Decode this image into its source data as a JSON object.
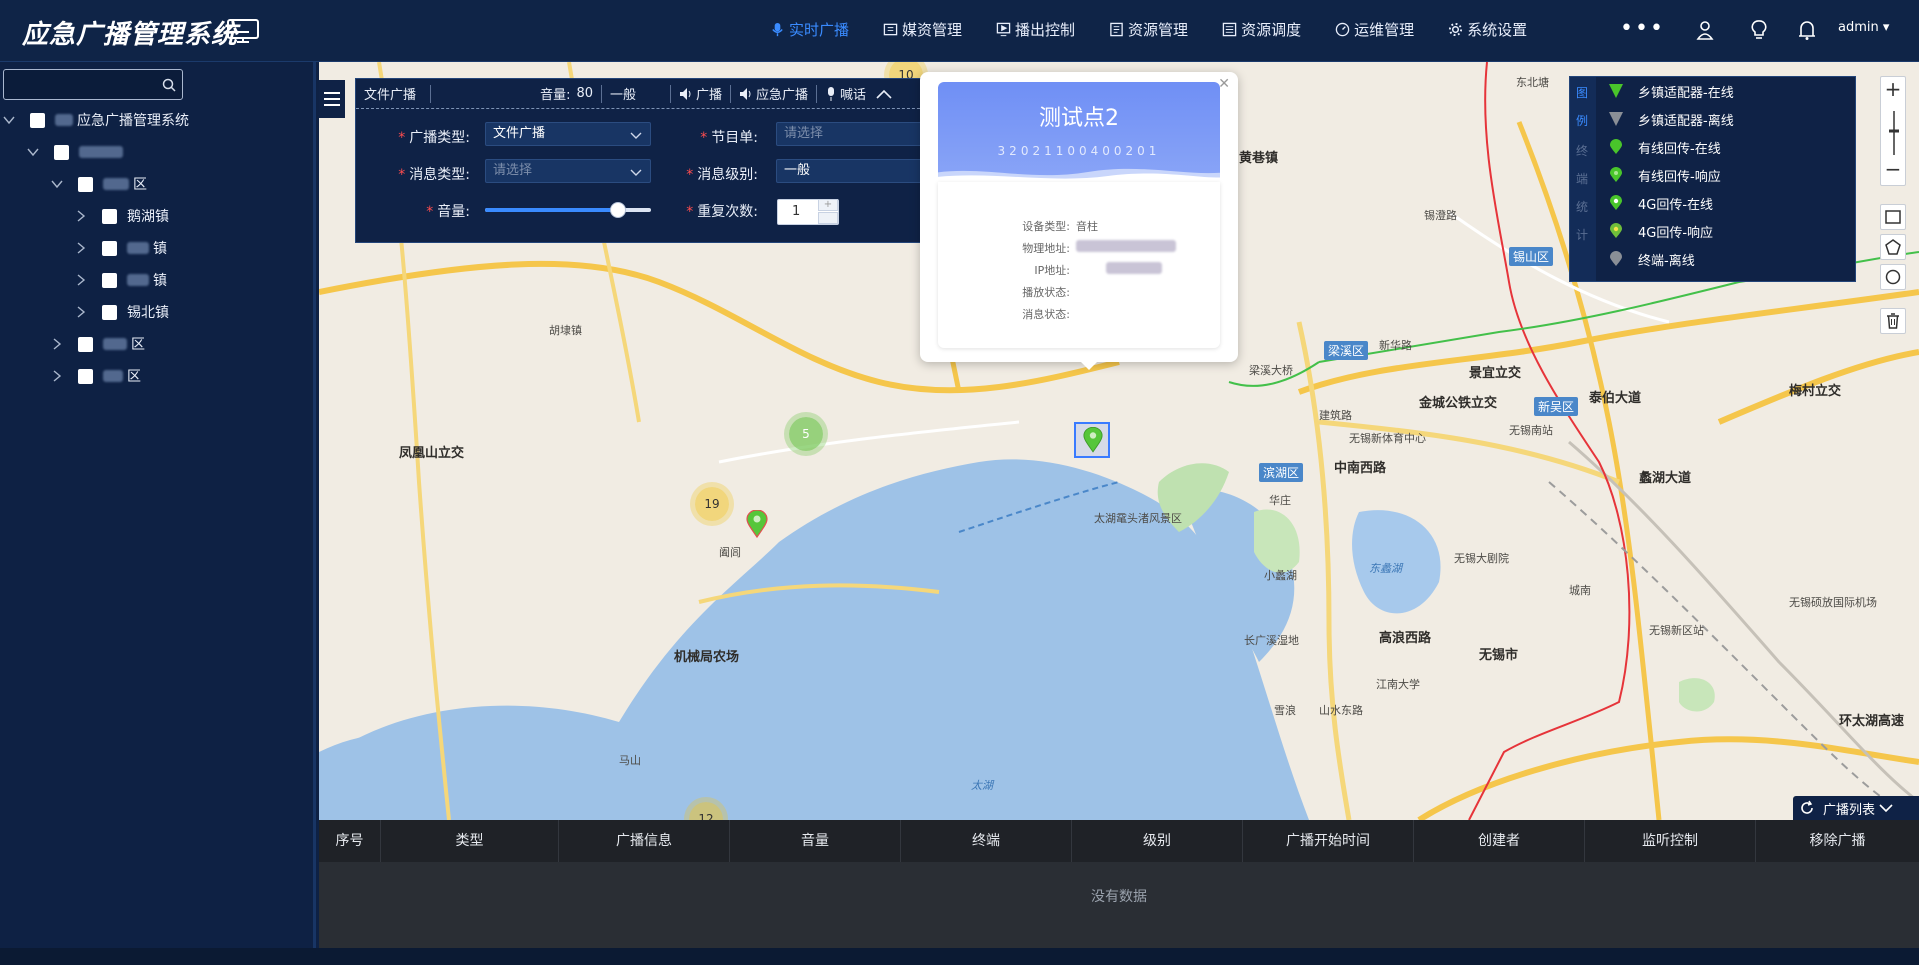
{
  "app": {
    "title": "应急广播管理系统"
  },
  "nav": {
    "items": [
      {
        "label": "实时广播",
        "icon": "mic-icon",
        "active": true
      },
      {
        "label": "媒资管理",
        "icon": "media-icon"
      },
      {
        "label": "播出控制",
        "icon": "monitor-play-icon"
      },
      {
        "label": "资源管理",
        "icon": "document-icon"
      },
      {
        "label": "资源调度",
        "icon": "list-icon"
      },
      {
        "label": "运维管理",
        "icon": "gauge-icon"
      },
      {
        "label": "系统设置",
        "icon": "gear-icon"
      }
    ],
    "more": "•••",
    "user": "admin ▾"
  },
  "tree": {
    "root": "应急广播管理系统",
    "district": "区",
    "towns": [
      "鹅湖镇",
      "镇",
      "镇",
      "锡北镇"
    ],
    "other1": "区",
    "other2": "区"
  },
  "broadcast_panel": {
    "toolbar": {
      "type": "文件广播",
      "volume_label": "音量:",
      "volume_value": "80",
      "level": "一般",
      "broadcast": "广播",
      "emergency": "应急广播",
      "shout": "喊话"
    },
    "form": {
      "type_label": "广播类型:",
      "type_value": "文件广播",
      "program_label": "节目单:",
      "program_placeholder": "请选择",
      "msgtype_label": "消息类型:",
      "msgtype_placeholder": "请选择",
      "msglevel_label": "消息级别:",
      "msglevel_value": "一般",
      "volume_label": "音量:",
      "volume_percent": 80,
      "repeat_label": "重复次数:",
      "repeat_value": "1"
    }
  },
  "popup": {
    "title": "测试点2",
    "id": "32021100400201",
    "rows": [
      {
        "key": "设备类型:",
        "value": "音柱"
      },
      {
        "key": "物理地址:",
        "value": ""
      },
      {
        "key": "IP地址:",
        "value": ""
      },
      {
        "key": "播放状态:",
        "value": ""
      },
      {
        "key": "消息状态:",
        "value": ""
      }
    ]
  },
  "legend": {
    "side_chars": [
      "图",
      "例",
      "终",
      "端",
      "统",
      "计"
    ],
    "items": [
      {
        "label": "乡镇适配器-在线",
        "icon": "adapter-online-icon",
        "color": "#49c52b"
      },
      {
        "label": "乡镇适配器-离线",
        "icon": "adapter-offline-icon",
        "color": "#8a8f96"
      },
      {
        "label": "有线回传-在线",
        "icon": "wired-online-icon",
        "color": "#49c52b"
      },
      {
        "label": "有线回传-响应",
        "icon": "wired-response-icon",
        "color": "#49c52b"
      },
      {
        "label": "4G回传-在线",
        "icon": "4g-online-icon",
        "color": "#49c52b"
      },
      {
        "label": "4G回传-响应",
        "icon": "4g-response-icon",
        "color": "#d9c020"
      },
      {
        "label": "终端-离线",
        "icon": "terminal-offline-icon",
        "color": "#8a8f96"
      }
    ]
  },
  "map": {
    "clusters": [
      {
        "count": "5",
        "kind": "green"
      },
      {
        "count": "19",
        "kind": "yellow"
      },
      {
        "count": "12",
        "kind": "yellow"
      },
      {
        "count": "10",
        "kind": "yellow"
      }
    ],
    "district_tags": [
      "锡山区",
      "梁溪区",
      "新吴区",
      "滨湖区"
    ],
    "labels": [
      "东北塘",
      "黄巷镇",
      "无锡新体育中心",
      "中南西路",
      "无锡大剧院",
      "太湖鼋头渚风景区",
      "东蠡湖",
      "无锡市",
      "高浪西路",
      "江南大学",
      "金城公铁立交",
      "泰伯大道",
      "无锡硕放国际机场",
      "环太湖高速",
      "机械局农场",
      "太湖",
      "凤凰山立交",
      "阖闾",
      "胡埭镇",
      "长广溪湿地",
      "梅村立交",
      "无锡新区站",
      "无锡南站",
      "蠡湖大道",
      "景宜立交",
      "城南",
      "小蠡湖",
      "华庄",
      "雪浪",
      "山水东路",
      "马山",
      "建筑路",
      "梁溪大桥",
      "锡澄路",
      "新华路"
    ]
  },
  "table": {
    "toggle_label": "广播列表",
    "columns": [
      "序号",
      "类型",
      "广播信息",
      "音量",
      "终端",
      "级别",
      "广播开始时间",
      "创建者",
      "监听控制",
      "移除广播"
    ],
    "empty_text": "没有数据"
  }
}
